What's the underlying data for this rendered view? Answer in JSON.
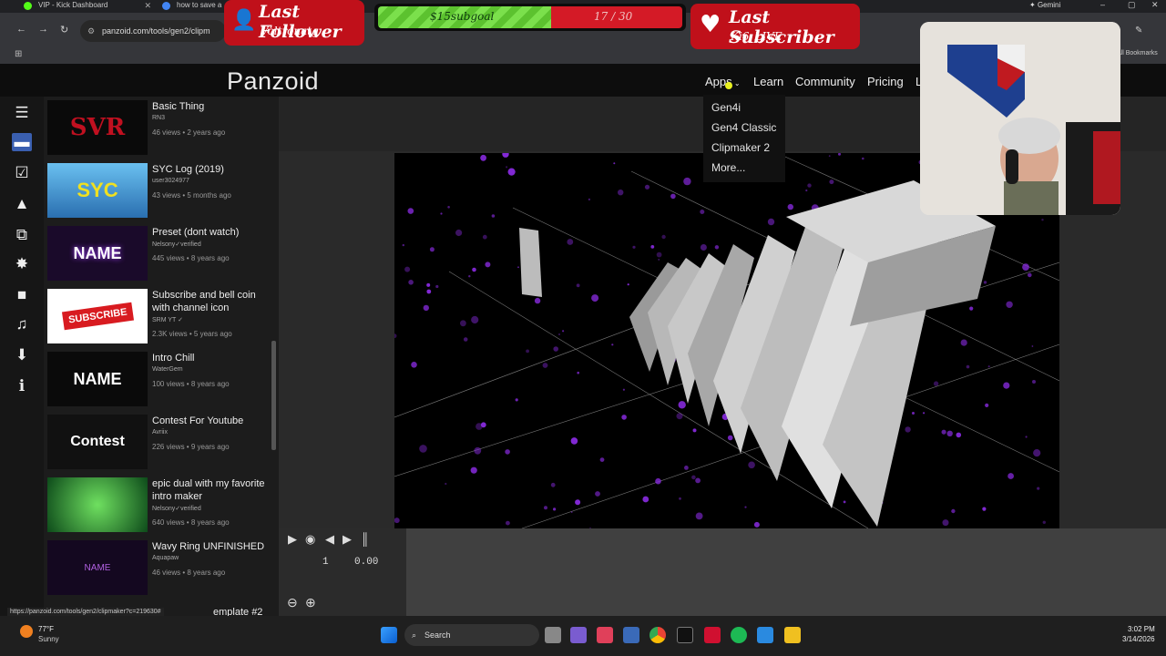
{
  "browser": {
    "tabs": [
      {
        "label": "VIP - Kick Dashboard"
      },
      {
        "label": "how to save a"
      }
    ],
    "gemini_label": "Gemini",
    "url": "panzoid.com/tools/gen2/clipm",
    "bookmarks_label": "All Bookmarks",
    "status_url": "https://panzoid.com/tools/gen2/clipmaker?c=219630#"
  },
  "overlay": {
    "last_follower_label": "Last Follower",
    "last_follower_name": "Voltronatg",
    "goal_label": "$15subgoal",
    "goal_count": "17 / 30",
    "goal_fraction": 0.5667,
    "last_subscriber_label": "Last Subscriber",
    "last_subscriber_name": "Ki6_LIVE"
  },
  "site": {
    "logo": "Panzoid",
    "nav": [
      "Apps",
      "Learn",
      "Community",
      "Pricing",
      "L"
    ],
    "apps_menu": [
      "Gen4i",
      "Gen4 Classic",
      "Clipmaker 2",
      "More..."
    ]
  },
  "sidebar_items": [
    {
      "title": "Basic Thing",
      "author": "RN3",
      "meta": "46 views • 2 years ago",
      "thumb": "SVR"
    },
    {
      "title": "SYC Log (2019)",
      "author": "user3024977",
      "meta": "43 views • 5 months ago",
      "thumb": "SYC"
    },
    {
      "title": "Preset (dont watch)",
      "author": "Nelsony✓verified",
      "meta": "445 views • 8 years ago",
      "thumb": "NAME"
    },
    {
      "title": "Subscribe and bell coin with channel icon",
      "author": "SRM YT ✓",
      "meta": "2.3K views • 5 years ago",
      "thumb": "SUBSCRIBE"
    },
    {
      "title": "Intro Chill",
      "author": "WaterGem",
      "meta": "100 views • 8 years ago",
      "thumb": "NAME"
    },
    {
      "title": "Contest For Youtube",
      "author": "Avriix",
      "meta": "226 views • 9 years ago",
      "thumb": "Contest"
    },
    {
      "title": "epic dual with my favorite intro maker",
      "author": "Nelsony✓verified",
      "meta": "640 views • 8 years ago",
      "thumb": ""
    },
    {
      "title": "Wavy Ring UNFINISHED",
      "author": "Aquapaw",
      "meta": "46 views • 8 years ago",
      "thumb": "NAME"
    },
    {
      "title": "emplate #2",
      "author": "",
      "meta": "",
      "thumb": ""
    }
  ],
  "timeline": {
    "frame": "1",
    "time": "0.00"
  },
  "taskbar": {
    "weather_temp": "77°F",
    "weather_desc": "Sunny",
    "search_label": "Search",
    "time": "3:02 PM",
    "date": "3/14/2026"
  },
  "colors": {
    "banner_red": "#c0101a",
    "goal_green": "#7be04c",
    "particles": "#8a2be2"
  }
}
